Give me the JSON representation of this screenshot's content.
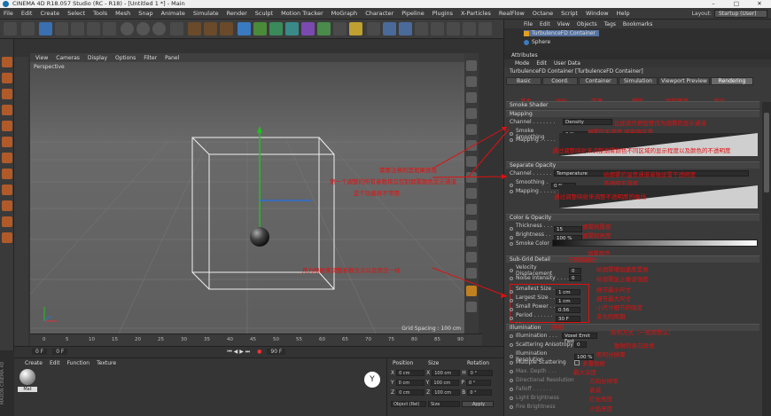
{
  "window": {
    "title": "CINEMA 4D R18.057 Studio (RC - R18) - [Untitled 1 *] - Main",
    "controls": [
      "–",
      "□",
      "✕"
    ]
  },
  "menubar": [
    "File",
    "Edit",
    "Create",
    "Select",
    "Tools",
    "Mesh",
    "Snap",
    "Animate",
    "Simulate",
    "Render",
    "Sculpt",
    "Motion Tracker",
    "MoGraph",
    "Character",
    "Pipeline",
    "Plugins",
    "X-Particles",
    "RealFlow",
    "Octane",
    "Script",
    "Window",
    "Help"
  ],
  "layout": {
    "label": "Layout:",
    "value": "Startup (User)"
  },
  "viewport": {
    "menu": [
      "View",
      "Cameras",
      "Display",
      "Options",
      "Filter",
      "Panel"
    ],
    "label": "Perspective",
    "grid_spacing": "Grid Spacing : 100 cm"
  },
  "timeline": {
    "ticks": [
      "0",
      "5",
      "10",
      "15",
      "20",
      "25",
      "30",
      "35",
      "40",
      "45",
      "50",
      "55",
      "60",
      "65",
      "70",
      "75",
      "80",
      "85",
      "90"
    ],
    "start": "0 F",
    "end": "90 F",
    "current": "0 F"
  },
  "material_manager": {
    "menu": [
      "Create",
      "Edit",
      "Function",
      "Texture"
    ],
    "material_name": "Mat"
  },
  "coords": {
    "headers": [
      "Position",
      "Size",
      "Rotation"
    ],
    "rows": [
      [
        "X",
        "0 cm",
        "X",
        "100 cm",
        "H",
        "0 °"
      ],
      [
        "Y",
        "0 cm",
        "Y",
        "100 cm",
        "P",
        "0 °"
      ],
      [
        "Z",
        "0 cm",
        "Z",
        "100 cm",
        "B",
        "0 °"
      ]
    ],
    "mode": "Object (Rel)",
    "size_mode": "Size",
    "apply": "Apply"
  },
  "brand": "MAXON CINEMA 4D",
  "object_manager": {
    "menu": [
      "File",
      "Edit",
      "View",
      "Objects",
      "Tags",
      "Bookmarks"
    ],
    "objects": [
      "TurbulenceFD Container",
      "Sphere"
    ]
  },
  "attributes": {
    "title": "Attributes",
    "menu": [
      "Mode",
      "Edit",
      "User Data"
    ],
    "object": "TurbulenceFD Container [TurbulenceFD Container]",
    "tabs": [
      "Basic",
      "Coord.",
      "Container",
      "Simulation",
      "Viewport Preview",
      "Rendering"
    ],
    "section_header": "Smoke Shader",
    "mapping": {
      "title": "Mapping",
      "channel_label": "Channel . . . . . . .",
      "channel_value": "Density",
      "smoothing_label": "Smoke Smoothing",
      "smoothing_value": "0 %",
      "mapping_label": "Mapping . . . . ."
    },
    "separate_opacity": {
      "title": "Separate Opacity",
      "channel_label": "Channel . . . . . .",
      "channel_value": "Temperature",
      "smoothing_label": "Smoothing . . .",
      "smoothing_value": "0 %",
      "mapping_label": "Mapping . . . . ."
    },
    "color_opacity": {
      "title": "Color & Opacity",
      "thickness_label": "Thickness . . . .",
      "thickness_value": "15",
      "brightness_label": "Brightness . . .",
      "brightness_value": "100 %",
      "color_label": "Smoke Color"
    },
    "subgrid": {
      "title": "Sub-Grid Detail",
      "velocity_label": "Velocity Displacement",
      "velocity_value": "0",
      "noise_label": "Noise Intensity . . . .",
      "noise_value": "0",
      "smallest_label": "Smallest Size . .",
      "smallest_value": "1 cm",
      "largest_label": "Largest Size . . .",
      "largest_value": "1 cm",
      "small_power_label": "Small Power . . .",
      "small_power_value": "0.56",
      "period_label": "Period . . . . . . . .",
      "period_value": "30 F"
    },
    "illumination": {
      "title": "Illumination",
      "illum_label": "Illumination . . .",
      "illum_value": "Voxel Emit Fast",
      "anisotropy_label": "Scattering Anisotropy",
      "anisotropy_value": "0",
      "resolution_label": "Illumination Resolution",
      "resolution_value": "100 %",
      "multiple_label": "Multiple Scattering",
      "max_depth_label": "Max. Depth . . .",
      "directional_label": "Directional Resolution",
      "falloff_label": "Falloff . . . . . .",
      "light_brightness_label": "Light Brightness",
      "fire_brightness_label": "Fire Brightness"
    }
  },
  "annotations": {
    "tab_labels": [
      "基本",
      "坐标",
      "容器",
      "模拟",
      "视窗预览",
      "渲染"
    ],
    "a1": "比如说只把密度作为烟雾的显示通道",
    "a2": "烟雾的平滑度 越高越平滑",
    "a3": "通过调整映射来调整烟雾颜色不同区域的显示程度以及颜色的不透明度",
    "a4": "给烟雾的温度通道单独设置不透明度",
    "a5": "不透明平滑度",
    "a6": "通过调整映射来调整不透明度的曲线",
    "a7": "烟雾的厚度",
    "a8": "烟雾的亮度",
    "a8b": "烟雾颜色",
    "a9": "子网格细分",
    "a10": "给烟雾增加速度置换",
    "a11": "给烟雾加上噪波强度",
    "a12": "细节最小尺寸",
    "a13": "细节最大尺寸",
    "a14": "小尺寸细节的强度",
    "a15": "变化的周期",
    "a16": "照明",
    "a17": "照明方式（一般用默认）",
    "a18": "散射的各向异性",
    "a19": "照明分辨率",
    "a20": "多重散射",
    "a21": "最大深度",
    "a22": "方向分辨率",
    "a23": "衰减",
    "a24": "灯光亮度",
    "a25": "火焰亮度",
    "vp1": "需要注意的是如果修改",
    "vp2": "第一个调整的所有参数将仅控制烟雾颜色显示通道",
    "vp3": "这个功能并不常用",
    "vp4": "用力映射来调整参数含义以及用法一样"
  },
  "colors": {
    "annotation": "#e01010",
    "accent_blue": "#2a6fd6",
    "gizmo_green": "#20c020",
    "gizmo_red": "#e03030"
  }
}
